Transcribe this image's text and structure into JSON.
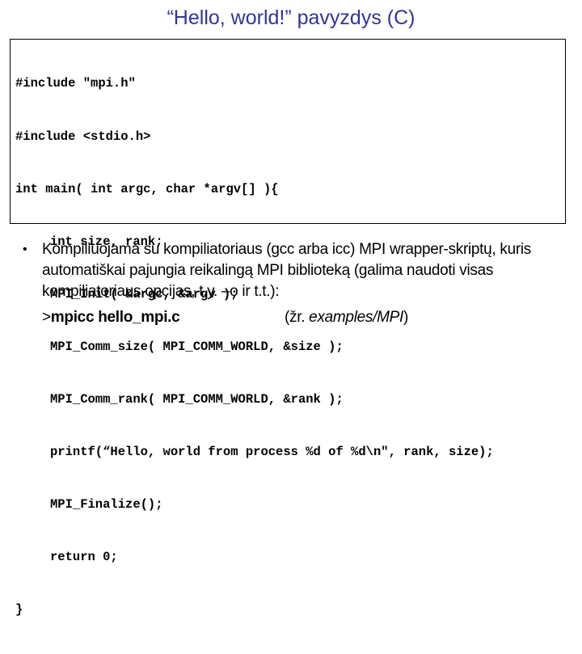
{
  "slide": {
    "title": "“Hello, world!” pavyzdys (C)",
    "title_color": "#333399"
  },
  "code": {
    "lines": [
      {
        "text": "#include \"mpi.h\"",
        "indent": false
      },
      {
        "text": "#include <stdio.h>",
        "indent": false
      },
      {
        "text": "int main( int argc, char *argv[] ){",
        "indent": false
      },
      {
        "text": "int size, rank;",
        "indent": true
      },
      {
        "text": "MPI_Init( &argc, &argv );",
        "indent": true
      },
      {
        "text": "MPI_Comm_size( MPI_COMM_WORLD, &size );",
        "indent": true
      },
      {
        "text": "MPI_Comm_rank( MPI_COMM_WORLD, &rank );",
        "indent": true
      },
      {
        "text": "printf(“Hello, world from process %d of %d\\n\", rank, size);",
        "indent": true
      },
      {
        "text": "MPI_Finalize();",
        "indent": true
      },
      {
        "text": "return 0;",
        "indent": true
      },
      {
        "text": "}",
        "indent": false
      }
    ]
  },
  "bullet": {
    "marker": "•",
    "text": "Kompiliuojama su kompiliatoriaus (gcc arba icc) MPI wrapper-skriptų, kuris automatiškai pajungia reikalingą MPI biblioteką (galima naudoti visas kompiliatoriaus opcijas, t.y. –o ir t.t.):"
  },
  "command": {
    "prompt": ">",
    "text": "mpicc hello_mpi.c",
    "ref_prefix": "(žr. ",
    "ref_path": "examples/MPI",
    "ref_suffix": ")"
  }
}
